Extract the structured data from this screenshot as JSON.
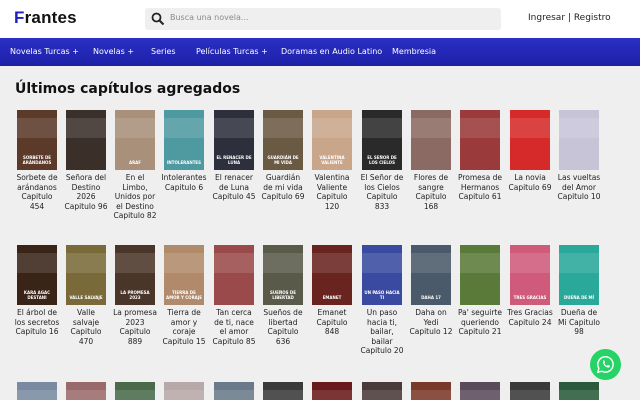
{
  "brand": {
    "first": "F",
    "rest": "rantes"
  },
  "search": {
    "placeholder": "Busca una novela..."
  },
  "account": {
    "login": "Ingresar",
    "sep": "|",
    "register": "Registro"
  },
  "nav": [
    {
      "label": "Novelas Turcas +"
    },
    {
      "label": "Novelas +"
    },
    {
      "label": "Series"
    },
    {
      "label": "Películas Turcas +"
    },
    {
      "label": "Doramas en Audio Latino"
    },
    {
      "label": "Membresia"
    }
  ],
  "heading": "Últimos capítulos agregados",
  "row1": [
    {
      "caption": "Sorbete de arándanos Capitulo 454",
      "poster_text": "Sorbete de arándanos",
      "color": "#5b3a2a"
    },
    {
      "caption": "Señora del Destino 2026 Capitulo 96",
      "poster_text": "",
      "color": "#3b2f2a"
    },
    {
      "caption": "En el Limbo, Unidos por el Destino Capitulo 82",
      "poster_text": "Araf",
      "color": "#a8907a"
    },
    {
      "caption": "Intolerantes Capitulo 6",
      "poster_text": "Intolerantes",
      "color": "#4f9aa0"
    },
    {
      "caption": "El renacer de Luna Capitulo 45",
      "poster_text": "El renacer de Luna",
      "color": "#2d2f3d"
    },
    {
      "caption": "Guardián de mi vida Capitulo 69",
      "poster_text": "Guardián de mi vida",
      "color": "#6a5a44"
    },
    {
      "caption": "Valentina Valiente Capitulo 120",
      "poster_text": "Valentina Valiente",
      "color": "#c9a58a"
    },
    {
      "caption": "El Señor de los Cielos Capitulo 833",
      "poster_text": "El Señor de los Cielos",
      "color": "#2a2a2a"
    },
    {
      "caption": "Flores de sangre Capitulo 168",
      "poster_text": "",
      "color": "#8a6a62"
    },
    {
      "caption": "Promesa de Hermanos Capitulo 61",
      "poster_text": "",
      "color": "#9a3a3a"
    },
    {
      "caption": "La novia Capitulo 69",
      "poster_text": "",
      "color": "#d62a2a"
    },
    {
      "caption": "Las vueltas del Amor Capitulo 10",
      "poster_text": "",
      "color": "#c8c4d8"
    }
  ],
  "row2": [
    {
      "caption": "El árbol de los secretos Capitulo 16",
      "poster_text": "Kara Agac Destani",
      "color": "#3a2418"
    },
    {
      "caption": "Valle salvaje Capitulo 470",
      "poster_text": "Valle Salvaje",
      "color": "#7a6a3a"
    },
    {
      "caption": "La promesa 2023 Capitulo 889",
      "poster_text": "La Promesa 2023",
      "color": "#4a3628"
    },
    {
      "caption": "Tierra de amor y coraje Capitulo 15",
      "poster_text": "Tierra de amor y coraje",
      "color": "#b08a6a"
    },
    {
      "caption": "Tan cerca de ti, nace el amor Capitulo 85",
      "poster_text": "",
      "color": "#9a4a4a"
    },
    {
      "caption": "Sueños de libertad Capitulo 636",
      "poster_text": "Sueños de libertad",
      "color": "#5a5a4a"
    },
    {
      "caption": "Emanet Capitulo 848",
      "poster_text": "Emanet",
      "color": "#6a2420"
    },
    {
      "caption": "Un paso hacia ti, bailar, bailar Capitulo 20",
      "poster_text": "Un paso hacia ti",
      "color": "#3a4aa0"
    },
    {
      "caption": "Daha on Yedi Capitulo 12",
      "poster_text": "Daha 17",
      "color": "#4a5a6a"
    },
    {
      "caption": "Pa' seguirte queriendo Capitulo 21",
      "poster_text": "",
      "color": "#5a7a3a"
    },
    {
      "caption": "Tres Gracias Capitulo 24",
      "poster_text": "Tres Gracias",
      "color": "#d05a7a"
    },
    {
      "caption": "Dueña de Mi Capitulo 98",
      "poster_text": "Dueña de mí",
      "color": "#2aa89a"
    }
  ],
  "row3": [
    {
      "color": "#7a8aa0"
    },
    {
      "color": "#9a6a6a"
    },
    {
      "color": "#4a6a4a"
    },
    {
      "color": "#b8a8a8"
    },
    {
      "color": "#6a7a8a"
    },
    {
      "color": "#3a3a3a"
    },
    {
      "color": "#6a1a1a"
    },
    {
      "color": "#4a3a3a"
    },
    {
      "color": "#7a3a2a"
    },
    {
      "color": "#5a4a5a"
    },
    {
      "color": "#3a3a3a"
    },
    {
      "color": "#2a5a3a"
    }
  ],
  "colors": {
    "nav_bg": "#2429b8",
    "accent_logo": "#1f1fbf",
    "whatsapp": "#25d366"
  },
  "icons": {
    "search": "search-icon",
    "whatsapp": "whatsapp-icon"
  }
}
